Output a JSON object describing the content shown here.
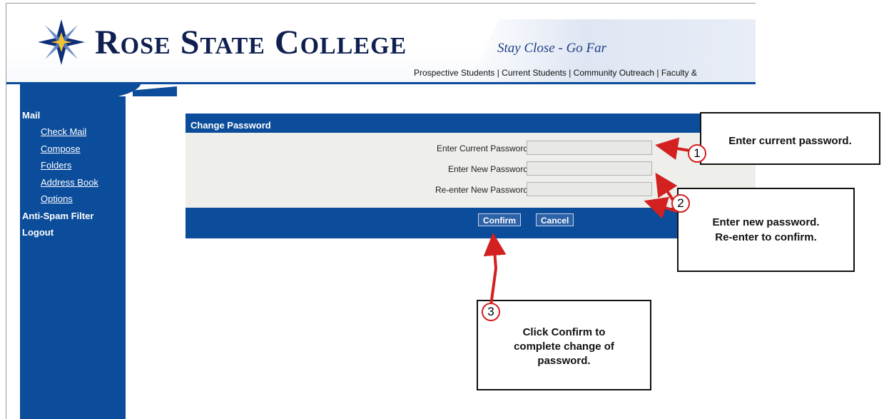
{
  "header": {
    "college_name": "Rose State College",
    "tagline": "Stay Close - Go Far",
    "nav_links": "Prospective Students | Current Students | Community Outreach | Faculty &"
  },
  "sidebar": {
    "section_label": "Mail",
    "items": [
      {
        "label": "Check Mail"
      },
      {
        "label": "Compose"
      },
      {
        "label": "Folders"
      },
      {
        "label": "Address Book"
      },
      {
        "label": "Options"
      }
    ],
    "anti_spam_label": "Anti-Spam Filter",
    "logout_label": "Logout"
  },
  "panel": {
    "title": "Change Password",
    "fields": [
      {
        "label": "Enter Current Password",
        "value": ""
      },
      {
        "label": "Enter New Password",
        "value": ""
      },
      {
        "label": "Re-enter New Password",
        "value": ""
      }
    ],
    "confirm_label": "Confirm",
    "cancel_label": "Cancel"
  },
  "callouts": [
    {
      "number": "1",
      "text": "Enter current password."
    },
    {
      "number": "2",
      "text_line1": "Enter new password.",
      "text_line2": "Re-enter to confirm."
    },
    {
      "number": "3",
      "text": "Click Confirm to complete change of password."
    }
  ],
  "colors": {
    "brand_blue": "#0b4c9b",
    "navy_text": "#0f2050",
    "arrow_red": "#d32020",
    "panel_gray": "#eeeeea"
  }
}
